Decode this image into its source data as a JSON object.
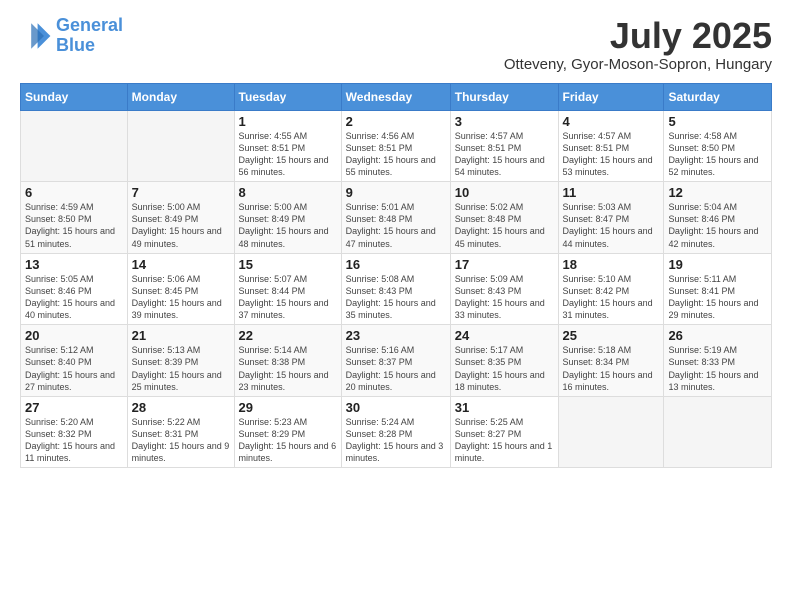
{
  "logo": {
    "line1": "General",
    "line2": "Blue"
  },
  "title": "July 2025",
  "subtitle": "Otteveny, Gyor-Moson-Sopron, Hungary",
  "days_of_week": [
    "Sunday",
    "Monday",
    "Tuesday",
    "Wednesday",
    "Thursday",
    "Friday",
    "Saturday"
  ],
  "weeks": [
    [
      {
        "day": "",
        "sunrise": "",
        "sunset": "",
        "daylight": ""
      },
      {
        "day": "",
        "sunrise": "",
        "sunset": "",
        "daylight": ""
      },
      {
        "day": "1",
        "sunrise": "Sunrise: 4:55 AM",
        "sunset": "Sunset: 8:51 PM",
        "daylight": "Daylight: 15 hours and 56 minutes."
      },
      {
        "day": "2",
        "sunrise": "Sunrise: 4:56 AM",
        "sunset": "Sunset: 8:51 PM",
        "daylight": "Daylight: 15 hours and 55 minutes."
      },
      {
        "day": "3",
        "sunrise": "Sunrise: 4:57 AM",
        "sunset": "Sunset: 8:51 PM",
        "daylight": "Daylight: 15 hours and 54 minutes."
      },
      {
        "day": "4",
        "sunrise": "Sunrise: 4:57 AM",
        "sunset": "Sunset: 8:51 PM",
        "daylight": "Daylight: 15 hours and 53 minutes."
      },
      {
        "day": "5",
        "sunrise": "Sunrise: 4:58 AM",
        "sunset": "Sunset: 8:50 PM",
        "daylight": "Daylight: 15 hours and 52 minutes."
      }
    ],
    [
      {
        "day": "6",
        "sunrise": "Sunrise: 4:59 AM",
        "sunset": "Sunset: 8:50 PM",
        "daylight": "Daylight: 15 hours and 51 minutes."
      },
      {
        "day": "7",
        "sunrise": "Sunrise: 5:00 AM",
        "sunset": "Sunset: 8:49 PM",
        "daylight": "Daylight: 15 hours and 49 minutes."
      },
      {
        "day": "8",
        "sunrise": "Sunrise: 5:00 AM",
        "sunset": "Sunset: 8:49 PM",
        "daylight": "Daylight: 15 hours and 48 minutes."
      },
      {
        "day": "9",
        "sunrise": "Sunrise: 5:01 AM",
        "sunset": "Sunset: 8:48 PM",
        "daylight": "Daylight: 15 hours and 47 minutes."
      },
      {
        "day": "10",
        "sunrise": "Sunrise: 5:02 AM",
        "sunset": "Sunset: 8:48 PM",
        "daylight": "Daylight: 15 hours and 45 minutes."
      },
      {
        "day": "11",
        "sunrise": "Sunrise: 5:03 AM",
        "sunset": "Sunset: 8:47 PM",
        "daylight": "Daylight: 15 hours and 44 minutes."
      },
      {
        "day": "12",
        "sunrise": "Sunrise: 5:04 AM",
        "sunset": "Sunset: 8:46 PM",
        "daylight": "Daylight: 15 hours and 42 minutes."
      }
    ],
    [
      {
        "day": "13",
        "sunrise": "Sunrise: 5:05 AM",
        "sunset": "Sunset: 8:46 PM",
        "daylight": "Daylight: 15 hours and 40 minutes."
      },
      {
        "day": "14",
        "sunrise": "Sunrise: 5:06 AM",
        "sunset": "Sunset: 8:45 PM",
        "daylight": "Daylight: 15 hours and 39 minutes."
      },
      {
        "day": "15",
        "sunrise": "Sunrise: 5:07 AM",
        "sunset": "Sunset: 8:44 PM",
        "daylight": "Daylight: 15 hours and 37 minutes."
      },
      {
        "day": "16",
        "sunrise": "Sunrise: 5:08 AM",
        "sunset": "Sunset: 8:43 PM",
        "daylight": "Daylight: 15 hours and 35 minutes."
      },
      {
        "day": "17",
        "sunrise": "Sunrise: 5:09 AM",
        "sunset": "Sunset: 8:43 PM",
        "daylight": "Daylight: 15 hours and 33 minutes."
      },
      {
        "day": "18",
        "sunrise": "Sunrise: 5:10 AM",
        "sunset": "Sunset: 8:42 PM",
        "daylight": "Daylight: 15 hours and 31 minutes."
      },
      {
        "day": "19",
        "sunrise": "Sunrise: 5:11 AM",
        "sunset": "Sunset: 8:41 PM",
        "daylight": "Daylight: 15 hours and 29 minutes."
      }
    ],
    [
      {
        "day": "20",
        "sunrise": "Sunrise: 5:12 AM",
        "sunset": "Sunset: 8:40 PM",
        "daylight": "Daylight: 15 hours and 27 minutes."
      },
      {
        "day": "21",
        "sunrise": "Sunrise: 5:13 AM",
        "sunset": "Sunset: 8:39 PM",
        "daylight": "Daylight: 15 hours and 25 minutes."
      },
      {
        "day": "22",
        "sunrise": "Sunrise: 5:14 AM",
        "sunset": "Sunset: 8:38 PM",
        "daylight": "Daylight: 15 hours and 23 minutes."
      },
      {
        "day": "23",
        "sunrise": "Sunrise: 5:16 AM",
        "sunset": "Sunset: 8:37 PM",
        "daylight": "Daylight: 15 hours and 20 minutes."
      },
      {
        "day": "24",
        "sunrise": "Sunrise: 5:17 AM",
        "sunset": "Sunset: 8:35 PM",
        "daylight": "Daylight: 15 hours and 18 minutes."
      },
      {
        "day": "25",
        "sunrise": "Sunrise: 5:18 AM",
        "sunset": "Sunset: 8:34 PM",
        "daylight": "Daylight: 15 hours and 16 minutes."
      },
      {
        "day": "26",
        "sunrise": "Sunrise: 5:19 AM",
        "sunset": "Sunset: 8:33 PM",
        "daylight": "Daylight: 15 hours and 13 minutes."
      }
    ],
    [
      {
        "day": "27",
        "sunrise": "Sunrise: 5:20 AM",
        "sunset": "Sunset: 8:32 PM",
        "daylight": "Daylight: 15 hours and 11 minutes."
      },
      {
        "day": "28",
        "sunrise": "Sunrise: 5:22 AM",
        "sunset": "Sunset: 8:31 PM",
        "daylight": "Daylight: 15 hours and 9 minutes."
      },
      {
        "day": "29",
        "sunrise": "Sunrise: 5:23 AM",
        "sunset": "Sunset: 8:29 PM",
        "daylight": "Daylight: 15 hours and 6 minutes."
      },
      {
        "day": "30",
        "sunrise": "Sunrise: 5:24 AM",
        "sunset": "Sunset: 8:28 PM",
        "daylight": "Daylight: 15 hours and 3 minutes."
      },
      {
        "day": "31",
        "sunrise": "Sunrise: 5:25 AM",
        "sunset": "Sunset: 8:27 PM",
        "daylight": "Daylight: 15 hours and 1 minute."
      },
      {
        "day": "",
        "sunrise": "",
        "sunset": "",
        "daylight": ""
      },
      {
        "day": "",
        "sunrise": "",
        "sunset": "",
        "daylight": ""
      }
    ]
  ]
}
